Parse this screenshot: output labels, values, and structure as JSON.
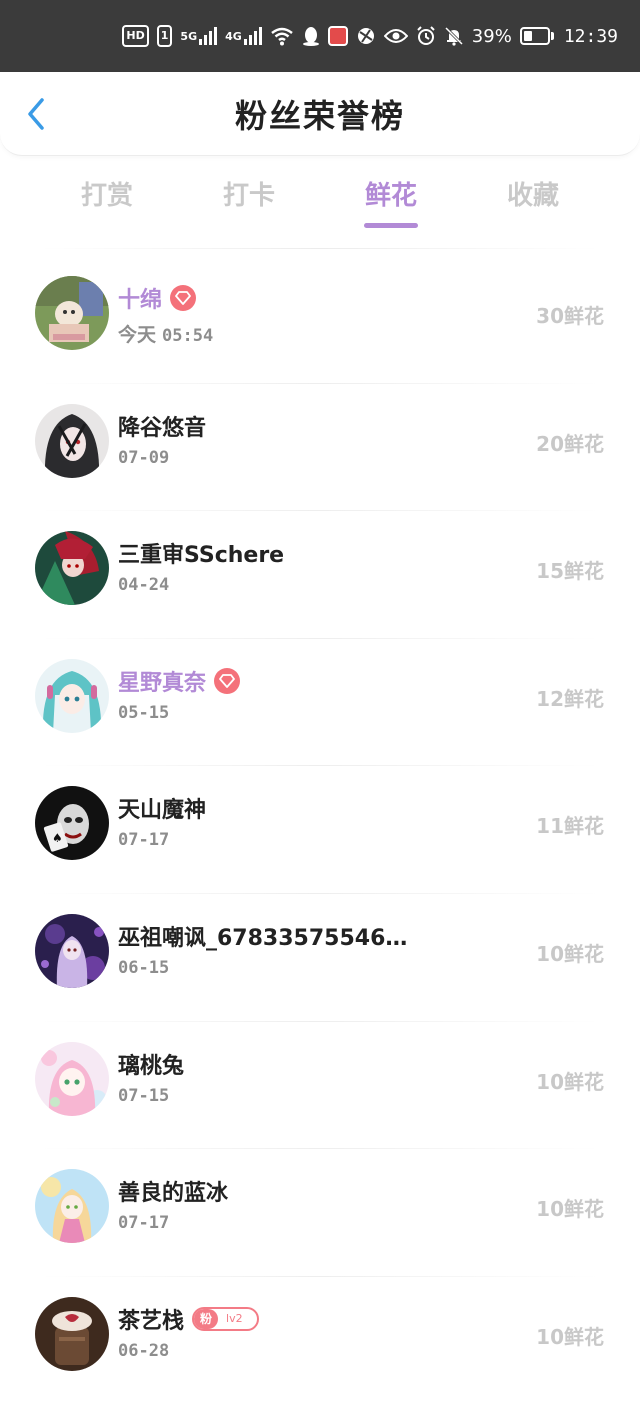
{
  "status_bar": {
    "hd": "HD",
    "sim": "1",
    "net1": "5G",
    "net2": "4G",
    "battery": "39%",
    "battery_level": 0.39,
    "time": "12:39"
  },
  "header": {
    "title": "粉丝荣誉榜"
  },
  "tabs": [
    {
      "label": "打赏",
      "active": false
    },
    {
      "label": "打卡",
      "active": false
    },
    {
      "label": "鲜花",
      "active": true
    },
    {
      "label": "收藏",
      "active": false
    }
  ],
  "fans": [
    {
      "name": "十绵",
      "vip": true,
      "badge": "gem",
      "day": "今天",
      "date": "05:54",
      "amount": "30鲜花",
      "avatar": "avatar-1"
    },
    {
      "name": "降谷悠音",
      "vip": false,
      "badge": "",
      "day": "",
      "date": "07-09",
      "amount": "20鲜花",
      "avatar": "avatar-2"
    },
    {
      "name": "三重审SSchere",
      "vip": false,
      "badge": "",
      "day": "",
      "date": "04-24",
      "amount": "15鲜花",
      "avatar": "avatar-3"
    },
    {
      "name": "星野真奈",
      "vip": true,
      "badge": "gem",
      "day": "",
      "date": "05-15",
      "amount": "12鲜花",
      "avatar": "avatar-4"
    },
    {
      "name": "天山魔神",
      "vip": false,
      "badge": "",
      "day": "",
      "date": "07-17",
      "amount": "11鲜花",
      "avatar": "avatar-5"
    },
    {
      "name": "巫祖嘲讽_67833575546…",
      "vip": false,
      "badge": "",
      "day": "",
      "date": "06-15",
      "amount": "10鲜花",
      "avatar": "avatar-6"
    },
    {
      "name": "璃桃兔",
      "vip": false,
      "badge": "",
      "day": "",
      "date": "07-15",
      "amount": "10鲜花",
      "avatar": "avatar-7"
    },
    {
      "name": "善良的蓝冰",
      "vip": false,
      "badge": "",
      "day": "",
      "date": "07-17",
      "amount": "10鲜花",
      "avatar": "avatar-8"
    },
    {
      "name": "茶艺栈",
      "vip": false,
      "badge": "fan",
      "fan_badge_left": "粉",
      "fan_badge_right": "lv2",
      "day": "",
      "date": "06-28",
      "amount": "10鲜花",
      "avatar": "avatar-9"
    }
  ],
  "colors": {
    "accent": "#b28ad6",
    "status_bar": "#3b3b3b",
    "back_arrow": "#3a9be6",
    "gem": "#f4717a",
    "amount": "#c8c8c8"
  }
}
